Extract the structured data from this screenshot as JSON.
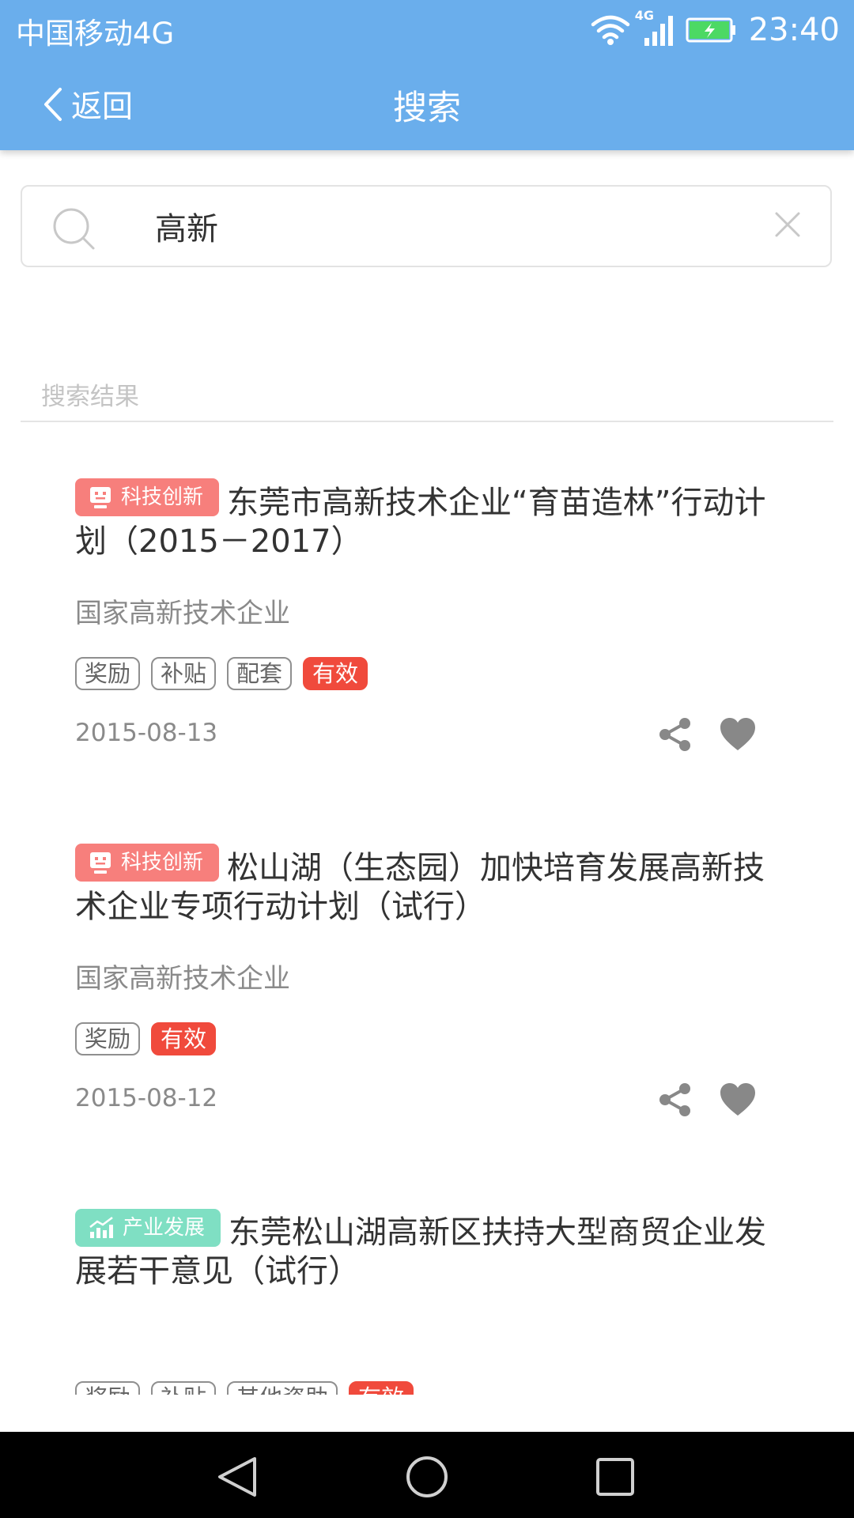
{
  "status_bar": {
    "carrier": "中国移动4G",
    "network": "4G",
    "time": "23:40"
  },
  "header": {
    "back_label": "返回",
    "title": "搜索"
  },
  "search": {
    "value": "高新",
    "placeholder": ""
  },
  "results_label": "搜索结果",
  "results": [
    {
      "category": "科技创新",
      "category_color": "#f77f7c",
      "title": "东莞市高新技术企业“育苗造林”行动计划（2015－2017）",
      "subtitle": "国家高新技术企业",
      "tags": [
        "奖励",
        "补贴",
        "配套"
      ],
      "status": "有效",
      "date": "2015-08-13"
    },
    {
      "category": "科技创新",
      "category_color": "#f77f7c",
      "title": "松山湖（生态园）加快培育发展高新技术企业专项行动计划（试行）",
      "subtitle": "国家高新技术企业",
      "tags": [
        "奖励"
      ],
      "status": "有效",
      "date": "2015-08-12"
    },
    {
      "category": "产业发展",
      "category_color": "#7fdfc3",
      "title": "东莞松山湖高新区扶持大型商贸企业发展若干意见（试行）",
      "subtitle": "",
      "tags": [
        "奖励",
        "补贴",
        "其他资助"
      ],
      "status": "有效",
      "date": ""
    }
  ],
  "icons": {
    "back": "chevron-left-icon",
    "search": "search-icon",
    "clear": "close-icon",
    "share": "share-icon",
    "favorite": "heart-icon",
    "category_tech": "robot-icon",
    "category_industry": "chart-up-icon"
  },
  "colors": {
    "header": "#6aaeec",
    "valid_status": "#f04a3c",
    "tech_tag": "#f77f7c",
    "industry_tag": "#7fdfc3"
  }
}
